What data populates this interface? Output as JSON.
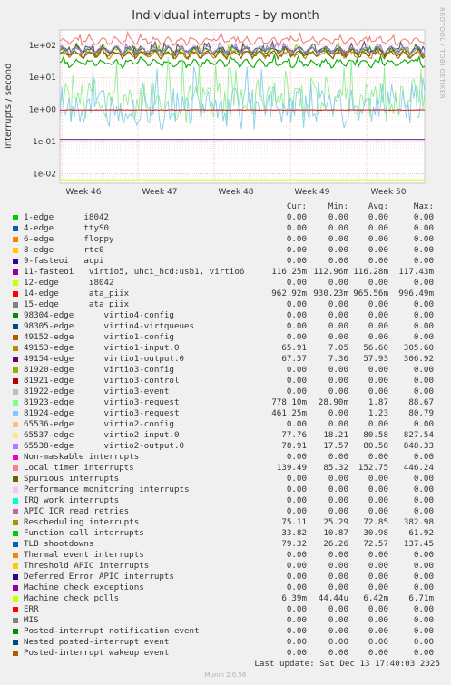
{
  "title": "Individual interrupts - by month",
  "side_label": "RRDTOOL / TOBI OETIKER",
  "footer": "Munin 2.0.56",
  "last_update": "Last update: Sat Dec 13 17:40:03 2025",
  "headers": {
    "cur": "Cur:",
    "min": "Min:",
    "avg": "Avg:",
    "max": "Max:"
  },
  "chart_data": {
    "type": "line",
    "title": "Individual interrupts - by month",
    "ylabel": "interrupts / second",
    "yscale": "log",
    "ylim": [
      0.005,
      300
    ],
    "y_ticks": [
      "1e-02",
      "1e-01",
      "1e+00",
      "1e+01",
      "1e+02"
    ],
    "x_ticks": [
      "Week 46",
      "Week 47",
      "Week 48",
      "Week 49",
      "Week 50"
    ],
    "grid": true,
    "series_approx": [
      {
        "name": "Local timer interrupts",
        "color": "#f08080",
        "level": 152.75
      },
      {
        "name": "Rescheduling interrupts",
        "color": "#9acd32",
        "level": 72.85
      },
      {
        "name": "TLB shootdowns",
        "color": "#228b22",
        "level": 72.57
      },
      {
        "name": "virtio1-input.0",
        "color": "#b8860b",
        "level": 56.6
      },
      {
        "name": "virtio1-output.0",
        "color": "#8b5a00",
        "level": 57.93
      },
      {
        "name": "virtio2-input.0",
        "color": "#555555",
        "level": 80.58
      },
      {
        "name": "virtio2-output.0",
        "color": "#a080e0",
        "level": 80.58
      },
      {
        "name": "Function call interrupts",
        "color": "#00aa00",
        "level": 30.98
      },
      {
        "name": "virtio3-request",
        "color": "#90ee90",
        "level": 1.87
      },
      {
        "name": "virtio3-request (81924)",
        "color": "#87ceeb",
        "level": 1.23
      },
      {
        "name": "ata_piix (14-edge)",
        "color": "#cc0000",
        "level": 0.96556
      },
      {
        "name": "virtio5, uhci_hcd:usb1, virtio6",
        "color": "#4b0082",
        "level": 0.11628
      },
      {
        "name": "Machine check polls",
        "color": "#ccff00",
        "level": 0.00642
      }
    ]
  },
  "rows": [
    {
      "label": "1-edge      i8042",
      "color": "#00cc00",
      "cur": "0.00",
      "min": "0.00",
      "avg": "0.00",
      "max": "0.00"
    },
    {
      "label": "4-edge      ttyS0",
      "color": "#0066b3",
      "cur": "0.00",
      "min": "0.00",
      "avg": "0.00",
      "max": "0.00"
    },
    {
      "label": "6-edge      floppy",
      "color": "#ff8000",
      "cur": "0.00",
      "min": "0.00",
      "avg": "0.00",
      "max": "0.00"
    },
    {
      "label": "8-edge      rtc0",
      "color": "#ffcc00",
      "cur": "0.00",
      "min": "0.00",
      "avg": "0.00",
      "max": "0.00"
    },
    {
      "label": "9-fasteoi   acpi",
      "color": "#330099",
      "cur": "0.00",
      "min": "0.00",
      "avg": "0.00",
      "max": "0.00"
    },
    {
      "label": "11-fasteoi   virtio5, uhci_hcd:usb1, virtio6",
      "color": "#990099",
      "cur": "116.25m",
      "min": "112.96m",
      "avg": "116.28m",
      "max": "117.43m"
    },
    {
      "label": "12-edge      i8042",
      "color": "#ccff00",
      "cur": "0.00",
      "min": "0.00",
      "avg": "0.00",
      "max": "0.00"
    },
    {
      "label": "14-edge      ata_piix",
      "color": "#ff0000",
      "cur": "962.92m",
      "min": "930.23m",
      "avg": "965.56m",
      "max": "996.49m"
    },
    {
      "label": "15-edge      ata_piix",
      "color": "#808080",
      "cur": "0.00",
      "min": "0.00",
      "avg": "0.00",
      "max": "0.00"
    },
    {
      "label": "98304-edge      virtio4-config",
      "color": "#008f00",
      "cur": "0.00",
      "min": "0.00",
      "avg": "0.00",
      "max": "0.00"
    },
    {
      "label": "98305-edge      virtio4-virtqueues",
      "color": "#00487d",
      "cur": "0.00",
      "min": "0.00",
      "avg": "0.00",
      "max": "0.00"
    },
    {
      "label": "49152-edge      virtio1-config",
      "color": "#b35a00",
      "cur": "0.00",
      "min": "0.00",
      "avg": "0.00",
      "max": "0.00"
    },
    {
      "label": "49153-edge      virtio1-input.0",
      "color": "#b38f00",
      "cur": "65.91",
      "min": "7.05",
      "avg": "56.60",
      "max": "305.60"
    },
    {
      "label": "49154-edge      virtio1-output.0",
      "color": "#6b006b",
      "cur": "67.57",
      "min": "7.36",
      "avg": "57.93",
      "max": "306.92"
    },
    {
      "label": "81920-edge      virtio3-config",
      "color": "#8fb300",
      "cur": "0.00",
      "min": "0.00",
      "avg": "0.00",
      "max": "0.00"
    },
    {
      "label": "81921-edge      virtio3-control",
      "color": "#b30000",
      "cur": "0.00",
      "min": "0.00",
      "avg": "0.00",
      "max": "0.00"
    },
    {
      "label": "81922-edge      virtio3-event",
      "color": "#bebebe",
      "cur": "0.00",
      "min": "0.00",
      "avg": "0.00",
      "max": "0.00"
    },
    {
      "label": "81923-edge      virtio3-request",
      "color": "#80ff80",
      "cur": "778.10m",
      "min": "28.90m",
      "avg": "1.87",
      "max": "88.67"
    },
    {
      "label": "81924-edge      virtio3-request",
      "color": "#80c9ff",
      "cur": "461.25m",
      "min": "0.00",
      "avg": "1.23",
      "max": "80.79"
    },
    {
      "label": "65536-edge      virtio2-config",
      "color": "#ffc080",
      "cur": "0.00",
      "min": "0.00",
      "avg": "0.00",
      "max": "0.00"
    },
    {
      "label": "65537-edge      virtio2-input.0",
      "color": "#ffe680",
      "cur": "77.76",
      "min": "18.21",
      "avg": "80.58",
      "max": "827.54"
    },
    {
      "label": "65538-edge      virtio2-output.0",
      "color": "#aa80ff",
      "cur": "78.91",
      "min": "17.57",
      "avg": "80.58",
      "max": "848.33"
    },
    {
      "label": "Non-maskable interrupts",
      "color": "#ee00cc",
      "cur": "0.00",
      "min": "0.00",
      "avg": "0.00",
      "max": "0.00"
    },
    {
      "label": "Local timer interrupts",
      "color": "#ff8080",
      "cur": "139.49",
      "min": "85.32",
      "avg": "152.75",
      "max": "446.24"
    },
    {
      "label": "Spurious interrupts",
      "color": "#666600",
      "cur": "0.00",
      "min": "0.00",
      "avg": "0.00",
      "max": "0.00"
    },
    {
      "label": "Performance monitoring interrupts",
      "color": "#ffbfff",
      "cur": "0.00",
      "min": "0.00",
      "avg": "0.00",
      "max": "0.00"
    },
    {
      "label": "IRQ work interrupts",
      "color": "#00ffcc",
      "cur": "0.00",
      "min": "0.00",
      "avg": "0.00",
      "max": "0.00"
    },
    {
      "label": "APIC ICR read retries",
      "color": "#cc6699",
      "cur": "0.00",
      "min": "0.00",
      "avg": "0.00",
      "max": "0.00"
    },
    {
      "label": "Rescheduling interrupts",
      "color": "#999900",
      "cur": "75.11",
      "min": "25.29",
      "avg": "72.85",
      "max": "382.98"
    },
    {
      "label": "Function call interrupts",
      "color": "#00cc00",
      "cur": "33.82",
      "min": "10.87",
      "avg": "30.98",
      "max": "61.92"
    },
    {
      "label": "TLB shootdowns",
      "color": "#0066b3",
      "cur": "79.32",
      "min": "26.26",
      "avg": "72.57",
      "max": "137.45"
    },
    {
      "label": "Thermal event interrupts",
      "color": "#ff8000",
      "cur": "0.00",
      "min": "0.00",
      "avg": "0.00",
      "max": "0.00"
    },
    {
      "label": "Threshold APIC interrupts",
      "color": "#ffcc00",
      "cur": "0.00",
      "min": "0.00",
      "avg": "0.00",
      "max": "0.00"
    },
    {
      "label": "Deferred Error APIC interrupts",
      "color": "#330099",
      "cur": "0.00",
      "min": "0.00",
      "avg": "0.00",
      "max": "0.00"
    },
    {
      "label": "Machine check exceptions",
      "color": "#990099",
      "cur": "0.00",
      "min": "0.00",
      "avg": "0.00",
      "max": "0.00"
    },
    {
      "label": "Machine check polls",
      "color": "#ccff00",
      "cur": "6.39m",
      "min": "44.44u",
      "avg": "6.42m",
      "max": "6.71m"
    },
    {
      "label": "ERR",
      "color": "#ff0000",
      "cur": "0.00",
      "min": "0.00",
      "avg": "0.00",
      "max": "0.00"
    },
    {
      "label": "MIS",
      "color": "#808080",
      "cur": "0.00",
      "min": "0.00",
      "avg": "0.00",
      "max": "0.00"
    },
    {
      "label": "Posted-interrupt notification event",
      "color": "#008f00",
      "cur": "0.00",
      "min": "0.00",
      "avg": "0.00",
      "max": "0.00"
    },
    {
      "label": "Nested posted-interrupt event",
      "color": "#00487d",
      "cur": "0.00",
      "min": "0.00",
      "avg": "0.00",
      "max": "0.00"
    },
    {
      "label": "Posted-interrupt wakeup event",
      "color": "#b35a00",
      "cur": "0.00",
      "min": "0.00",
      "avg": "0.00",
      "max": "0.00"
    }
  ]
}
